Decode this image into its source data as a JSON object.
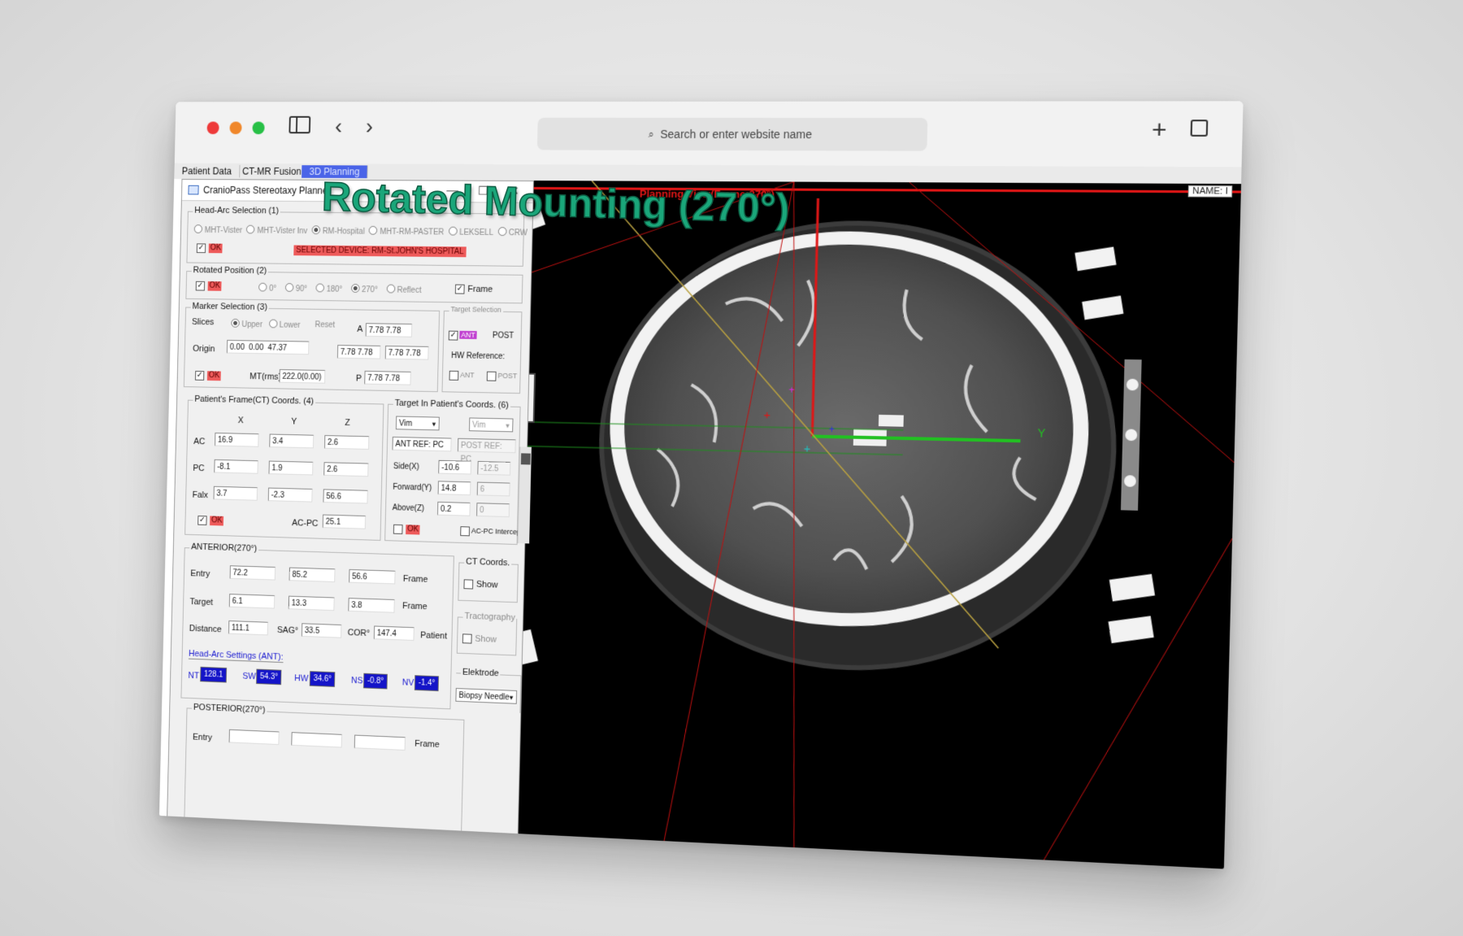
{
  "browser": {
    "search_placeholder": "Search or enter website name"
  },
  "tabs": [
    {
      "label": "Patient Data"
    },
    {
      "label": "CT-MR Fusion"
    },
    {
      "label": "3D Planning"
    }
  ],
  "name_label": "NAME: I",
  "overlay_title": "Rotated Mounting (270°)",
  "viewer": {
    "title": "Planning View(Frame:270°)",
    "axis_y": "Y"
  },
  "window": {
    "title": "CranioPass Stereotaxy Planner",
    "minimize": "—",
    "maximize": "☐",
    "close": "✕"
  },
  "head_arc": {
    "label": "Head-Arc Selection",
    "num": "(1)",
    "options": [
      "MHT-Vister",
      "MHT-Vister Inv",
      "RM-Hospital",
      "MHT-RM-PASTER",
      "LEKSELL",
      "CRW"
    ],
    "ok": "OK",
    "selected_device": "SELECTED DEVICE: RM-St.JOHN'S HOSPITAL"
  },
  "rotated": {
    "label": "Rotated Position",
    "num": "(2)",
    "ok": "OK",
    "options": [
      "0°",
      "90°",
      "180°",
      "270°",
      "Reflect"
    ],
    "frame": "Frame"
  },
  "marker": {
    "label": "Marker Selection",
    "num": "(3)",
    "slices": "Slices",
    "upper": "Upper",
    "lower": "Lower",
    "reset": "Reset",
    "origin": "Origin",
    "origin_vals": [
      "0.00",
      "0.00",
      "47.37"
    ],
    "a_label": "A",
    "a_val": "7.78 7.78",
    "row2_a": "7.78 7.78",
    "row2_b": "7.78 7.78",
    "p_label": "P",
    "p_val": "7.78 7.78",
    "ok": "OK",
    "mt_label": "MT(rms)",
    "mt_val": "222.0(0.00)",
    "target_sel": "Target Selection",
    "ant": "ANT",
    "post": "POST",
    "hw_ref": "HW Reference:",
    "hw_ant": "ANT",
    "hw_post": "POST"
  },
  "patient_frame": {
    "label": "Patient's Frame(CT) Coords.",
    "num": "(4)",
    "cols": [
      "X",
      "Y",
      "Z"
    ],
    "rows": [
      {
        "name": "AC",
        "vals": [
          "16.9",
          "3.4",
          "2.6"
        ]
      },
      {
        "name": "PC",
        "vals": [
          "-8.1",
          "1.9",
          "2.6"
        ]
      },
      {
        "name": "Falx",
        "vals": [
          "3.7",
          "-2.3",
          "56.6"
        ]
      }
    ],
    "ok": "OK",
    "acpc_label": "AC-PC",
    "acpc_val": "25.1"
  },
  "target_coords": {
    "label": "Target In Patient's Coords.",
    "num": "(6)",
    "target1": "Vim",
    "target2": "Vim",
    "ant_ref": "ANT REF: PC",
    "post_ref": "POST REF: PC",
    "side_label": "Side(X)",
    "side": [
      "-10.6",
      "-12.5"
    ],
    "forward_label": "Forward(Y)",
    "forward": [
      "14.8",
      "6"
    ],
    "above_label": "Above(Z)",
    "above": [
      "0.2",
      "0"
    ],
    "ok": "OK",
    "acpc_intercept": "AC-PC Intercep"
  },
  "anterior": {
    "label": "ANTERIOR(270°)",
    "entry_label": "Entry",
    "entry": [
      "72.2",
      "85.2",
      "56.6"
    ],
    "target_label": "Target",
    "target": [
      "6.1",
      "13.3",
      "3.8"
    ],
    "frame_label": "Frame",
    "distance_label": "Distance",
    "distance": "111.1",
    "sag_label": "SAG°",
    "sag": "33.5",
    "cor_label": "COR°",
    "cor": "147.4",
    "patient_label": "Patient",
    "head_arc_settings": "Head-Arc Settings (ANT):",
    "settings": [
      {
        "name": "NT",
        "val": "128.1"
      },
      {
        "name": "SW",
        "val": "54.3°"
      },
      {
        "name": "HW",
        "val": "34.6°"
      },
      {
        "name": "NS",
        "val": "-0.8°"
      },
      {
        "name": "NV",
        "val": "-1.4°"
      }
    ]
  },
  "ct_coords": {
    "label": "CT Coords.",
    "show": "Show"
  },
  "tractography": {
    "label": "Tractography",
    "show": "Show"
  },
  "elektrode": {
    "label": "Elektrode",
    "value": "Biopsy Needle"
  },
  "posterior": {
    "label": "POSTERIOR(270°)",
    "entry_label": "Entry",
    "frame_label": "Frame"
  },
  "colors": {
    "accent_tab": "#4a64e8",
    "ok_red": "#ee5a5a",
    "arc_blue": "#1414c8",
    "overlay_green": "#1aa67a"
  }
}
